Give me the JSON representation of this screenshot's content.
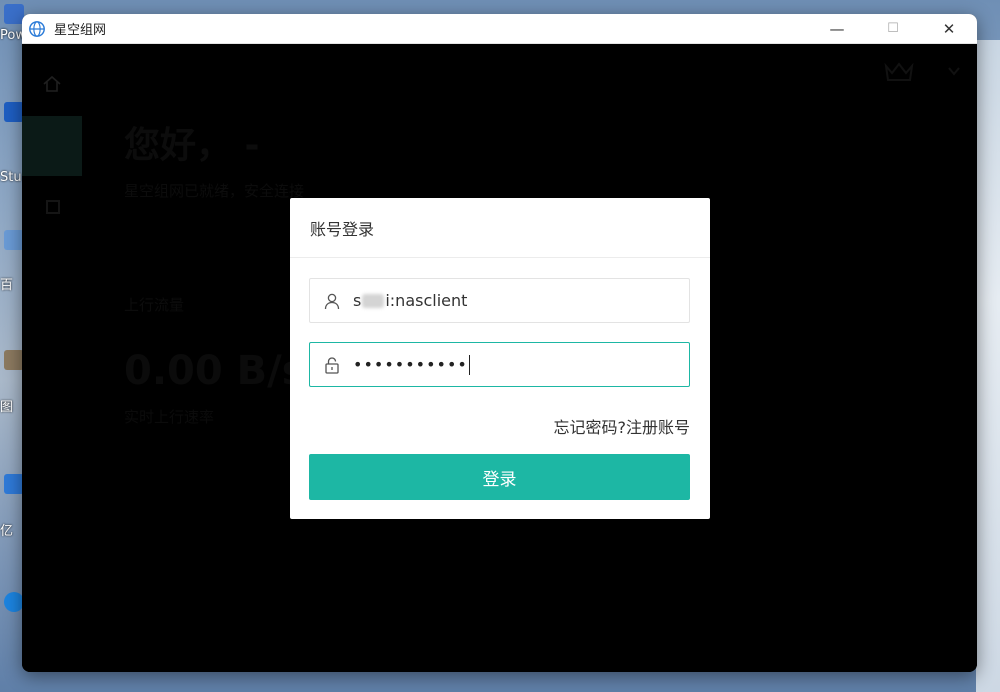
{
  "window": {
    "title": "星空组网",
    "controls": {
      "minimize": "—",
      "maximize": "☐",
      "close": "✕"
    }
  },
  "desktop": {
    "labels": [
      "Pow",
      "Stu",
      "百",
      "图",
      "亿"
    ]
  },
  "background": {
    "greeting": "您好， -",
    "greeting_sub": "星空组网已就绪，安全连接",
    "upload_label": "上行流量",
    "upload_speed": "0.00 B/s",
    "upload_sub": "实时上行速率"
  },
  "login": {
    "title": "账号登录",
    "username_prefix": "s",
    "username_suffix": "i:nasclient",
    "password_mask": "•••••••••••",
    "forgot_password": "忘记密码?",
    "register": "注册账号",
    "submit": "登录"
  },
  "colors": {
    "accent": "#1db7a4",
    "titlebar": "#ffffff",
    "overlay": "#000000"
  },
  "icons": {
    "app": "globe-icon",
    "user": "user-icon",
    "lock": "lock-icon"
  }
}
